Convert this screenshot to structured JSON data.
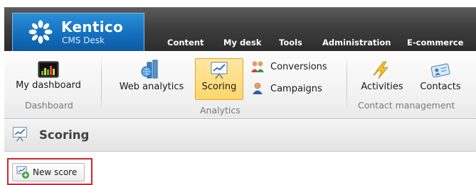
{
  "header": {
    "logo_name": "Kentico",
    "logo_subtitle": "CMS Desk",
    "tabs": [
      "Content",
      "My desk",
      "Tools",
      "Administration",
      "E-commerce"
    ]
  },
  "ribbon": {
    "dashboard": {
      "item_label": "My dashboard",
      "group_label": "Dashboard"
    },
    "analytics": {
      "web_analytics_label": "Web analytics",
      "scoring_label": "Scoring",
      "conversions_label": "Conversions",
      "campaigns_label": "Campaigns",
      "group_label": "Analytics"
    },
    "contact_management": {
      "activities_label": "Activities",
      "contacts_label": "Contacts",
      "group_label": "Contact management"
    }
  },
  "page": {
    "title": "Scoring",
    "new_score_label": "New score"
  },
  "colors": {
    "accent_blue": "#1470bf",
    "active_highlight": "#fdd66c",
    "annotation_red": "#d3252b"
  }
}
